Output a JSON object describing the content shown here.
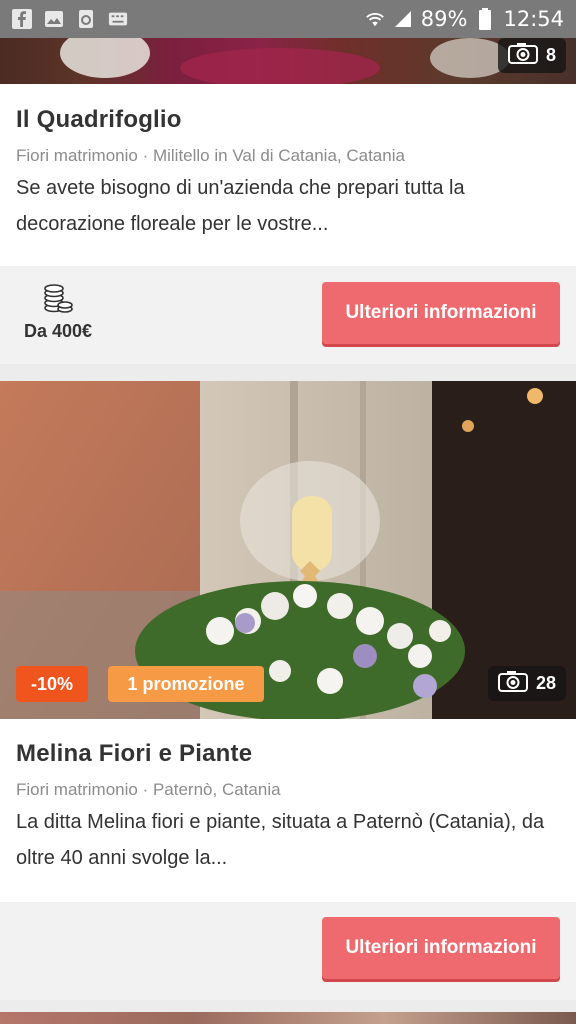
{
  "status_bar": {
    "battery": "89%",
    "time": "12:54",
    "icons": [
      "facebook-icon",
      "gallery-icon",
      "recycle-icon",
      "keyboard-icon",
      "wifi-icon",
      "signal-icon",
      "battery-icon"
    ]
  },
  "listings": [
    {
      "photo_count": "8",
      "title": "Il Quadrifoglio",
      "meta": "Fiori matrimonio · Militello in Val di Catania, Catania",
      "description": "Se avete bisogno di un'azienda che prepari tutta la decorazione floreale per le vostre...",
      "price": "Da 400€",
      "button_label": "Ulteriori informazioni"
    },
    {
      "photo_count": "28",
      "discount_tag": "-10%",
      "promo_tag": "1 promozione",
      "title": "Melina Fiori e Piante",
      "meta": "Fiori matrimonio · Paternò, Catania",
      "description": "La ditta Melina fiori e piante, situata a Paternò (Catania), da oltre 40 anni svolge la...",
      "button_label": "Ulteriori informazioni"
    }
  ],
  "colors": {
    "button": "#ef6a6e",
    "discount_tag": "#f0551e",
    "promo_tag": "#f79a45"
  }
}
